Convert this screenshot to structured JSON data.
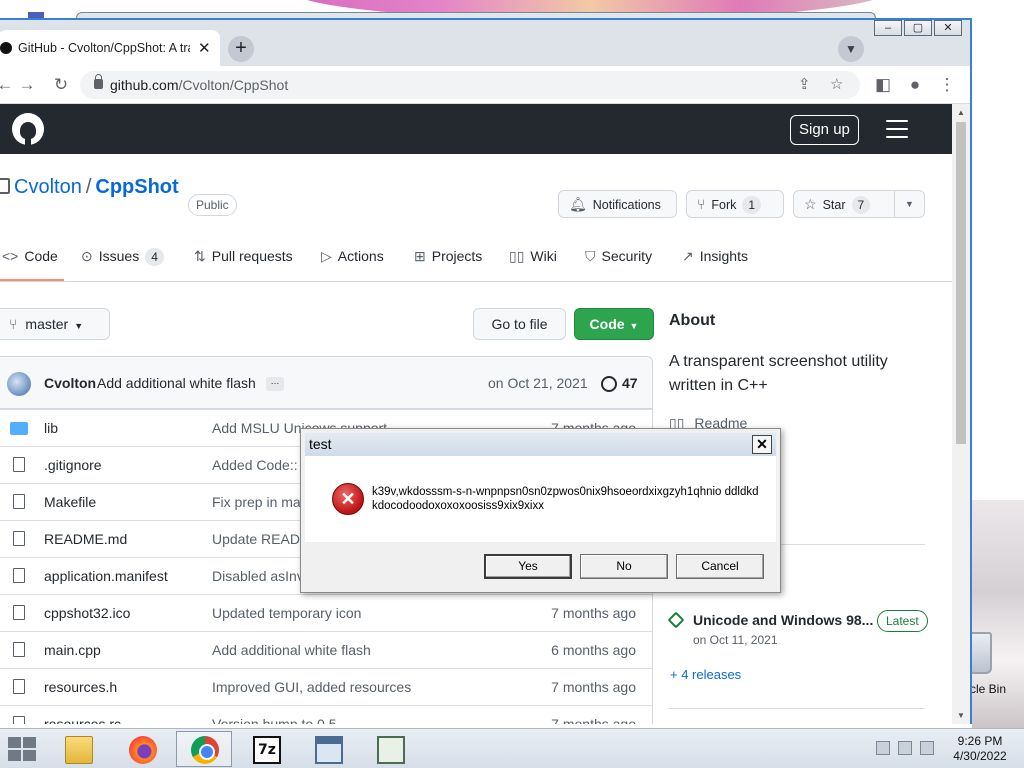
{
  "browser": {
    "tab_title": "GitHub - Cvolton/CppShot: A tra",
    "tab_close": "✕",
    "new_tab": "+",
    "window_controls": [
      "–",
      "▢",
      "✕"
    ],
    "url_host": "github.com",
    "url_path": "/Cvolton/CppShot",
    "nav_back": "←",
    "nav_forward": "→",
    "nav_reload": "↻",
    "menu": "⋮"
  },
  "header": {
    "signup_label": "Sign up"
  },
  "repo": {
    "owner": "Cvolton",
    "separator": "/",
    "name": "CppShot",
    "visibility": "Public",
    "notifications_label": "Notifications",
    "fork_label": "Fork",
    "fork_count": "1",
    "star_label": "Star",
    "star_count": "7"
  },
  "tabs": [
    {
      "label": "Code",
      "icon": "code-icon",
      "glyph": "<>"
    },
    {
      "label": "Issues",
      "icon": "issue-icon",
      "glyph": "⊙",
      "count": "4"
    },
    {
      "label": "Pull requests",
      "icon": "pull-request-icon",
      "glyph": "⇅"
    },
    {
      "label": "Actions",
      "icon": "play-icon",
      "glyph": "▷"
    },
    {
      "label": "Projects",
      "icon": "table-icon",
      "glyph": "⊞"
    },
    {
      "label": "Wiki",
      "icon": "book-icon",
      "glyph": "▯▯"
    },
    {
      "label": "Security",
      "icon": "shield-icon",
      "glyph": "⛉"
    },
    {
      "label": "Insights",
      "icon": "graph-icon",
      "glyph": "↗"
    }
  ],
  "toolbar": {
    "branch_label": "master",
    "goto_file_label": "Go to file",
    "code_label": "Code"
  },
  "commit": {
    "author": "Cvolton",
    "message": "Add additional white flash",
    "ellipsis": "…",
    "date": "on Oct 21, 2021",
    "count": "47"
  },
  "files": [
    {
      "name": "lib",
      "type": "dir",
      "message": "Add MSLU Unicows support",
      "age": "7 months ago"
    },
    {
      "name": ".gitignore",
      "type": "file",
      "message": "Added Code::",
      "age": ""
    },
    {
      "name": "Makefile",
      "type": "file",
      "message": "Fix prep in ma",
      "age": ""
    },
    {
      "name": "README.md",
      "type": "file",
      "message": "Update READ",
      "age": ""
    },
    {
      "name": "application.manifest",
      "type": "file",
      "message": "Disabled asInv",
      "age": ""
    },
    {
      "name": "cppshot32.ico",
      "type": "file",
      "message": "Updated temporary icon",
      "age": "7 months ago"
    },
    {
      "name": "main.cpp",
      "type": "file",
      "message": "Add additional white flash",
      "age": "6 months ago"
    },
    {
      "name": "resources.h",
      "type": "file",
      "message": "Improved GUI, added resources",
      "age": "7 months ago"
    },
    {
      "name": "resources.rc",
      "type": "file",
      "message": "Version bump to 0.5",
      "age": "7 months ago"
    }
  ],
  "about": {
    "heading": "About",
    "description": "A transparent screenshot utility written in C++",
    "readme_label": "Readme",
    "release_name": "Unicode and Windows 98...",
    "latest_badge": "Latest",
    "release_date": "on Oct 11, 2021",
    "releases_link": "+ 4 releases"
  },
  "dialog": {
    "title": "test",
    "close": "✕",
    "message": "k39v,wkdosssm-s-n-wnpnpsn0sn0zpwos0nix9hsoeordxixgzyh1qhnio ddldkdkdocodoodoxoxoxoosiss9xix9xixx",
    "buttons": [
      "Yes",
      "No",
      "Cancel"
    ]
  },
  "desktop": {
    "recycle_label": "cle Bin"
  },
  "taskbar": {
    "sevenzip_label": "7z",
    "time": "9:26 PM",
    "date": "4/30/2022"
  },
  "colors": {
    "github_header": "#24292f",
    "link": "#0969da",
    "code_button": "#2da44e",
    "active_tab_underline": "#fd8c73",
    "error_red": "#c01818"
  }
}
